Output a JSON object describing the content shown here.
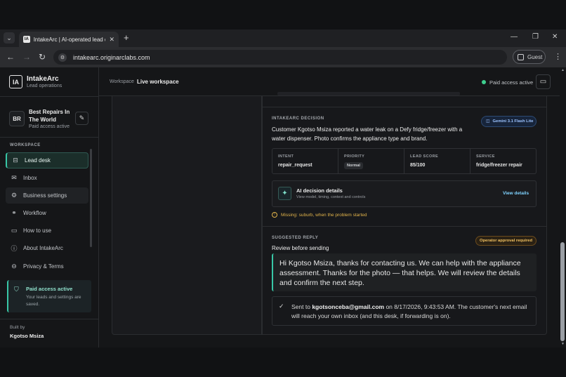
{
  "browser": {
    "tab_title": "IntakeArc | AI-operated lead de",
    "tab_favicon": "IA",
    "url": "intakearc.originarclabs.com",
    "guest_label": "Guest"
  },
  "sidebar": {
    "logo": "IA",
    "brand_name": "IntakeArc",
    "brand_sub": "Lead operations",
    "avatar": "BR",
    "business_name": "Best Repairs In The World",
    "business_status": "Paid access active",
    "section_label": "WORKSPACE",
    "items": [
      {
        "label": "Lead desk",
        "icon": "inbox-tray-icon",
        "active": true
      },
      {
        "label": "Inbox",
        "icon": "mail-icon"
      },
      {
        "label": "Business settings",
        "icon": "gear-icon"
      },
      {
        "label": "Workflow",
        "icon": "workflow-icon"
      },
      {
        "label": "How to use",
        "icon": "book-icon"
      },
      {
        "label": "About IntakeArc",
        "icon": "info-icon"
      },
      {
        "label": "Privacy & Terms",
        "icon": "lock-icon"
      }
    ],
    "paid_card": {
      "title": "Paid access active",
      "desc": "Your leads and settings are saved."
    },
    "built_by_label": "Built by",
    "built_by_name": "Kgotso Msiza"
  },
  "header": {
    "crumb_workspace": "Workspace",
    "crumb_current": "Live workspace",
    "status": "Paid access active",
    "status_color": "#3ecf8e"
  },
  "decision": {
    "section_label": "INTAKEARC DECISION",
    "model_badge": "Gemini 3.1 Flash Lite",
    "summary": "Customer Kgotso Msiza reported a water leak on a Defy fridge/freezer with a water dispenser. Photo confirms the appliance type and brand.",
    "grid": {
      "intent_label": "INTENT",
      "intent": "repair_request",
      "priority_label": "PRIORITY",
      "priority": "Normal",
      "score_label": "LEAD SCORE",
      "score": "85/100",
      "service_label": "SERVICE",
      "service": "fridge/freezer repair"
    },
    "ai_details": {
      "title": "AI decision details",
      "sub": "View model, timing, context and controls",
      "action": "View details"
    },
    "missing": "Missing: suburb, when the problem started"
  },
  "reply": {
    "section_label": "SUGGESTED REPLY",
    "review_label": "Review before sending",
    "badge": "Operator approval required",
    "text": "Hi Kgotso Msiza, thanks for contacting us. We can help with the appliance assessment. Thanks for the photo — that helps. We will review the details and confirm the next step.",
    "sent_prefix": "Sent to ",
    "sent_email": "kgotsonceba@gmail.com",
    "sent_suffix": " on 8/17/2026, 9:43:53 AM. The customer's next email will reach your own inbox (and this desk, if forwarding is on)."
  },
  "colors": {
    "accent": "#38c7a6",
    "warning": "#e0b24a",
    "link": "#7fd3ff"
  }
}
